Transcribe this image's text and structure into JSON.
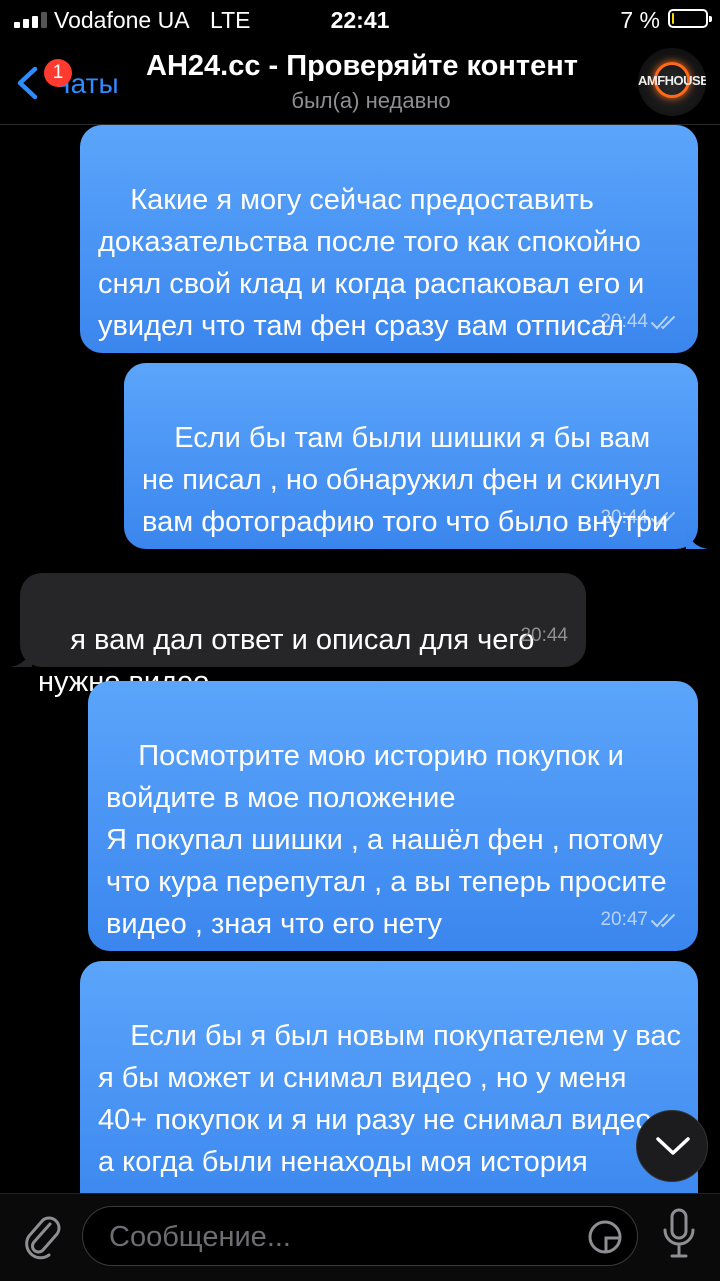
{
  "status_bar": {
    "carrier": "Vodafone UA",
    "network": "LTE",
    "time": "22:41",
    "battery_percent_label": "7 %",
    "battery_level": 0.07
  },
  "nav": {
    "back_label": "Чаты",
    "unread_badge": "1",
    "title": "AH24.cc - Проверяйте контент",
    "subtitle": "был(а) недавно",
    "avatar_text": "AMFHOUSE"
  },
  "messages": [
    {
      "direction": "out",
      "text": "Какие я могу сейчас предоставить доказательства после того как спокойно снял свой клад и когда распаковал его и увидел что там фен сразу вам отписал",
      "time": "20:44",
      "status": "read"
    },
    {
      "direction": "out",
      "text": "Если бы там были шишки я бы вам не писал , но обнаружил фен и скинул вам фотографию того что было внутри",
      "time": "20:44",
      "status": "read"
    },
    {
      "direction": "in",
      "text": "я вам дал ответ и описал для чего нужно видео",
      "time": "20:44"
    },
    {
      "direction": "out",
      "text": "Посмотрите мою историю покупок и войдите в мое положение\nЯ покупал шишки , а нашёл фен , потому что кура перепутал , а вы теперь просите видео , зная что его нету",
      "time": "20:47",
      "status": "read"
    },
    {
      "direction": "out",
      "text": "Если бы я был новым покупателем у вас я бы может и снимал видео , но у меня 40+ покупок и я ни разу не снимал видео , а когда были ненаходы моя история покупок",
      "time": "",
      "status": ""
    }
  ],
  "input": {
    "placeholder": "Сообщение..."
  },
  "colors": {
    "outgoing_bubble": "#4a96f5",
    "incoming_bubble": "#262628",
    "accent": "#2f8cff",
    "badge": "#ff3b30"
  },
  "icons": {
    "back": "chevron-left-icon",
    "attach": "paperclip-icon",
    "sticker": "sticker-icon",
    "mic": "microphone-icon",
    "scroll_down": "chevron-down-icon"
  }
}
